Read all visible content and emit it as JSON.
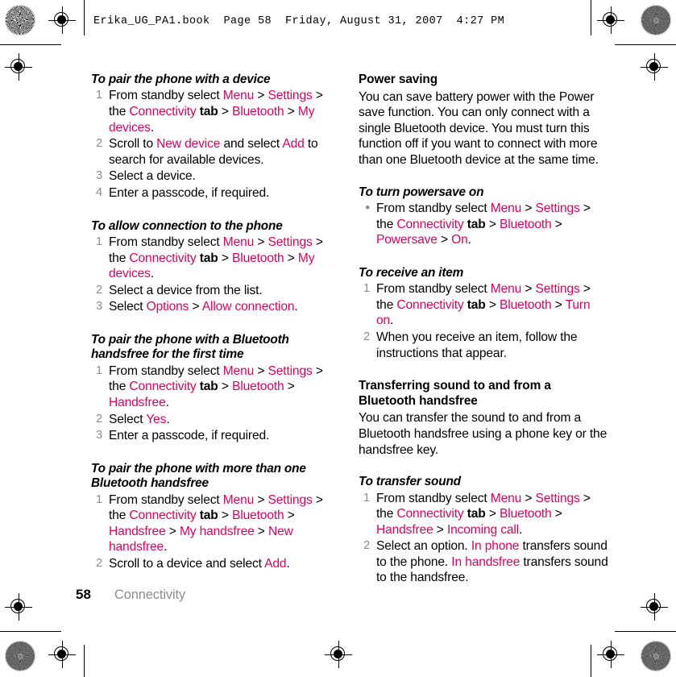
{
  "slug": {
    "text": "Erika_UG_PA1.book  Page 58  Friday, August 31, 2007  4:27 PM"
  },
  "colors": {
    "link": "#e4005a",
    "marker": "#8c8c8c",
    "text": "#000000",
    "running_head": "#8c8c8c"
  },
  "footer": {
    "page_number": "58",
    "running_head": "Connectivity"
  },
  "left_column": {
    "sections": [
      {
        "heading": "To pair the phone with a device",
        "list_type": "ordered",
        "items": [
          {
            "marker": "1",
            "parts": [
              {
                "t": "From standby select ",
                "s": "plain"
              },
              {
                "t": "Menu",
                "s": "link"
              },
              {
                "t": " > ",
                "s": "plain"
              },
              {
                "t": "Settings",
                "s": "link"
              },
              {
                "t": " > the ",
                "s": "plain"
              },
              {
                "t": "Connectivity",
                "s": "link"
              },
              {
                "t": " tab",
                "s": "bold"
              },
              {
                "t": " > ",
                "s": "plain"
              },
              {
                "t": "Bluetooth",
                "s": "link"
              },
              {
                "t": " > ",
                "s": "plain"
              },
              {
                "t": "My devices",
                "s": "link"
              },
              {
                "t": ".",
                "s": "plain"
              }
            ]
          },
          {
            "marker": "2",
            "parts": [
              {
                "t": "Scroll to ",
                "s": "plain"
              },
              {
                "t": "New device",
                "s": "link"
              },
              {
                "t": " and select ",
                "s": "plain"
              },
              {
                "t": "Add",
                "s": "link"
              },
              {
                "t": " to search for available devices.",
                "s": "plain"
              }
            ]
          },
          {
            "marker": "3",
            "parts": [
              {
                "t": "Select a device.",
                "s": "plain"
              }
            ]
          },
          {
            "marker": "4",
            "parts": [
              {
                "t": "Enter a passcode, if required.",
                "s": "plain"
              }
            ]
          }
        ]
      },
      {
        "heading": "To allow connection to the phone",
        "list_type": "ordered",
        "items": [
          {
            "marker": "1",
            "parts": [
              {
                "t": "From standby select ",
                "s": "plain"
              },
              {
                "t": "Menu",
                "s": "link"
              },
              {
                "t": " > ",
                "s": "plain"
              },
              {
                "t": "Settings",
                "s": "link"
              },
              {
                "t": " > the ",
                "s": "plain"
              },
              {
                "t": "Connectivity",
                "s": "link"
              },
              {
                "t": " tab",
                "s": "bold"
              },
              {
                "t": " > ",
                "s": "plain"
              },
              {
                "t": "Bluetooth",
                "s": "link"
              },
              {
                "t": " > ",
                "s": "plain"
              },
              {
                "t": "My devices",
                "s": "link"
              },
              {
                "t": ".",
                "s": "plain"
              }
            ]
          },
          {
            "marker": "2",
            "parts": [
              {
                "t": "Select a device from the list.",
                "s": "plain"
              }
            ]
          },
          {
            "marker": "3",
            "parts": [
              {
                "t": "Select ",
                "s": "plain"
              },
              {
                "t": "Options",
                "s": "link"
              },
              {
                "t": " > ",
                "s": "plain"
              },
              {
                "t": "Allow connection",
                "s": "link"
              },
              {
                "t": ".",
                "s": "plain"
              }
            ]
          }
        ]
      },
      {
        "heading": "To pair the phone with a Bluetooth handsfree for the first time",
        "list_type": "ordered",
        "items": [
          {
            "marker": "1",
            "parts": [
              {
                "t": "From standby select ",
                "s": "plain"
              },
              {
                "t": "Menu",
                "s": "link"
              },
              {
                "t": " > ",
                "s": "plain"
              },
              {
                "t": "Settings",
                "s": "link"
              },
              {
                "t": " > the ",
                "s": "plain"
              },
              {
                "t": "Connectivity",
                "s": "link"
              },
              {
                "t": " tab",
                "s": "bold"
              },
              {
                "t": " > ",
                "s": "plain"
              },
              {
                "t": "Bluetooth",
                "s": "link"
              },
              {
                "t": " > ",
                "s": "plain"
              },
              {
                "t": "Handsfree",
                "s": "link"
              },
              {
                "t": ".",
                "s": "plain"
              }
            ]
          },
          {
            "marker": "2",
            "parts": [
              {
                "t": "Select ",
                "s": "plain"
              },
              {
                "t": "Yes",
                "s": "link"
              },
              {
                "t": ".",
                "s": "plain"
              }
            ]
          },
          {
            "marker": "3",
            "parts": [
              {
                "t": "Enter a passcode, if required.",
                "s": "plain"
              }
            ]
          }
        ]
      },
      {
        "heading": "To pair the phone with more than one Bluetooth handsfree",
        "list_type": "ordered",
        "items": [
          {
            "marker": "1",
            "parts": [
              {
                "t": "From standby select ",
                "s": "plain"
              },
              {
                "t": "Menu",
                "s": "link"
              },
              {
                "t": " > ",
                "s": "plain"
              },
              {
                "t": "Settings",
                "s": "link"
              },
              {
                "t": " > the ",
                "s": "plain"
              },
              {
                "t": "Connectivity",
                "s": "link"
              },
              {
                "t": " tab",
                "s": "bold"
              },
              {
                "t": " > ",
                "s": "plain"
              },
              {
                "t": "Bluetooth",
                "s": "link"
              },
              {
                "t": " > ",
                "s": "plain"
              },
              {
                "t": "Handsfree",
                "s": "link"
              },
              {
                "t": " > ",
                "s": "plain"
              },
              {
                "t": "My handsfree",
                "s": "link"
              },
              {
                "t": " > ",
                "s": "plain"
              },
              {
                "t": "New handsfree",
                "s": "link"
              },
              {
                "t": ".",
                "s": "plain"
              }
            ]
          },
          {
            "marker": "2",
            "parts": [
              {
                "t": "Scroll to a device and select ",
                "s": "plain"
              },
              {
                "t": "Add",
                "s": "link"
              },
              {
                "t": ".",
                "s": "plain"
              }
            ]
          }
        ]
      }
    ]
  },
  "right_column": {
    "power_saving": {
      "heading": "Power saving",
      "body": "You can save battery power with the Power save function. You can only connect with a single Bluetooth device. You must turn this function off if you want to connect with more than one Bluetooth device at the same time."
    },
    "sections": [
      {
        "heading": "To turn powersave on",
        "list_type": "bullet",
        "items": [
          {
            "marker": "•",
            "parts": [
              {
                "t": "From standby select ",
                "s": "plain"
              },
              {
                "t": "Menu",
                "s": "link"
              },
              {
                "t": " > ",
                "s": "plain"
              },
              {
                "t": "Settings",
                "s": "link"
              },
              {
                "t": " > the ",
                "s": "plain"
              },
              {
                "t": "Connectivity",
                "s": "link"
              },
              {
                "t": " tab",
                "s": "bold"
              },
              {
                "t": " > ",
                "s": "plain"
              },
              {
                "t": "Bluetooth",
                "s": "link"
              },
              {
                "t": " > ",
                "s": "plain"
              },
              {
                "t": "Powersave",
                "s": "link"
              },
              {
                "t": " > ",
                "s": "plain"
              },
              {
                "t": "On",
                "s": "link"
              },
              {
                "t": ".",
                "s": "plain"
              }
            ]
          }
        ]
      },
      {
        "heading": "To receive an item",
        "list_type": "ordered",
        "items": [
          {
            "marker": "1",
            "parts": [
              {
                "t": "From standby select ",
                "s": "plain"
              },
              {
                "t": "Menu",
                "s": "link"
              },
              {
                "t": " > ",
                "s": "plain"
              },
              {
                "t": "Settings",
                "s": "link"
              },
              {
                "t": " > the ",
                "s": "plain"
              },
              {
                "t": "Connectivity",
                "s": "link"
              },
              {
                "t": " tab",
                "s": "bold"
              },
              {
                "t": " > ",
                "s": "plain"
              },
              {
                "t": "Bluetooth",
                "s": "link"
              },
              {
                "t": " > ",
                "s": "plain"
              },
              {
                "t": "Turn on",
                "s": "link"
              },
              {
                "t": ".",
                "s": "plain"
              }
            ]
          },
          {
            "marker": "2",
            "parts": [
              {
                "t": "When you receive an item, follow the instructions that appear.",
                "s": "plain"
              }
            ]
          }
        ]
      }
    ],
    "transferring_sound": {
      "heading": "Transferring sound to and from a Bluetooth handsfree",
      "body": "You can transfer the sound to and from a Bluetooth handsfree using a phone key or the handsfree key."
    },
    "transfer_section": {
      "heading": "To transfer sound",
      "list_type": "ordered",
      "items": [
        {
          "marker": "1",
          "parts": [
            {
              "t": "From standby select ",
              "s": "plain"
            },
            {
              "t": "Menu",
              "s": "link"
            },
            {
              "t": " > ",
              "s": "plain"
            },
            {
              "t": "Settings",
              "s": "link"
            },
            {
              "t": " > the ",
              "s": "plain"
            },
            {
              "t": "Connectivity",
              "s": "link"
            },
            {
              "t": " tab",
              "s": "bold"
            },
            {
              "t": " > ",
              "s": "plain"
            },
            {
              "t": "Bluetooth",
              "s": "link"
            },
            {
              "t": " > ",
              "s": "plain"
            },
            {
              "t": "Handsfree",
              "s": "link"
            },
            {
              "t": " > ",
              "s": "plain"
            },
            {
              "t": "Incoming call",
              "s": "link"
            },
            {
              "t": ".",
              "s": "plain"
            }
          ]
        },
        {
          "marker": "2",
          "parts": [
            {
              "t": "Select an option. ",
              "s": "plain"
            },
            {
              "t": "In phone",
              "s": "link"
            },
            {
              "t": " transfers sound to the phone. ",
              "s": "plain"
            },
            {
              "t": "In handsfree",
              "s": "link"
            },
            {
              "t": " transfers sound to the handsfree.",
              "s": "plain"
            }
          ]
        }
      ]
    }
  },
  "print_marks": {
    "registration_icon": "registration-target-icon",
    "rosette_icon": "color-rosette-icon",
    "count": 6
  }
}
